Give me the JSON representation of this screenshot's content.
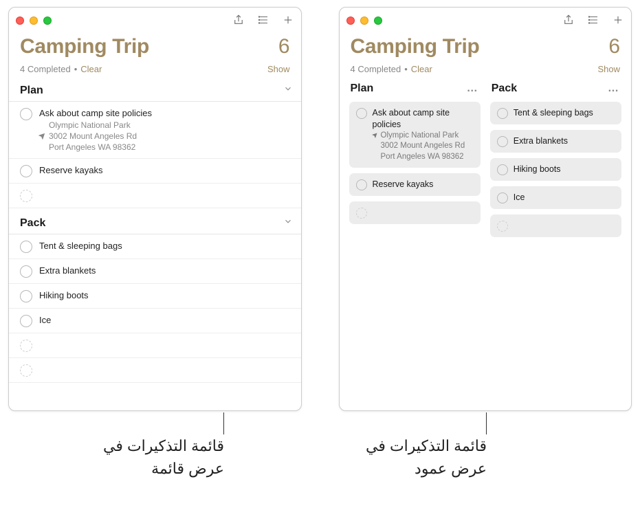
{
  "title": "Camping Trip",
  "count": "6",
  "completed_text": "4 Completed",
  "clear_label": "Clear",
  "show_label": "Show",
  "sections": {
    "plan": {
      "name": "Plan",
      "items": [
        {
          "title": "Ask about camp site policies",
          "location_name": "Olympic National Park",
          "address_line1": "3002 Mount Angeles Rd",
          "address_line2": "Port Angeles WA 98362"
        },
        {
          "title": "Reserve kayaks"
        }
      ]
    },
    "pack": {
      "name": "Pack",
      "items": [
        {
          "title": "Tent & sleeping bags"
        },
        {
          "title": "Extra blankets"
        },
        {
          "title": "Hiking boots"
        },
        {
          "title": "Ice"
        }
      ]
    }
  },
  "captions": {
    "list_view": "قائمة التذكيرات في عرض قائمة",
    "column_view": "قائمة التذكيرات في عرض عمود"
  }
}
